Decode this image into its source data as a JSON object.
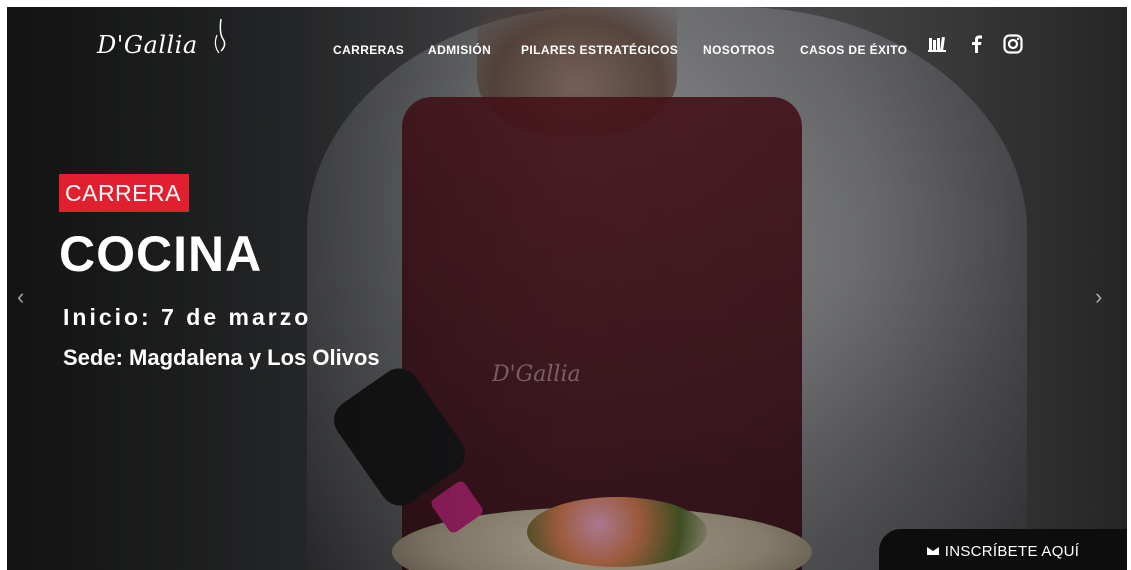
{
  "brand": {
    "logo_text": "D'Gallia"
  },
  "nav": {
    "items": [
      {
        "label": "CARRERAS"
      },
      {
        "label": "ADMISIÓN"
      },
      {
        "label": "PILARES ESTRATÉGICOS"
      },
      {
        "label": "NOSOTROS"
      },
      {
        "label": "CASOS DE ÉXITO"
      }
    ],
    "icons": [
      "library-icon",
      "facebook-icon",
      "instagram-icon"
    ]
  },
  "hero": {
    "badge": "CARRERA",
    "title": "COCINA",
    "start": "Inicio: 7 de marzo",
    "campus": "Sede: Magdalena y Los Olivos"
  },
  "carousel": {
    "prev_icon": "chevron-left-icon",
    "next_icon": "chevron-right-icon"
  },
  "cta": {
    "label": "INSCRÍBETE AQUÍ",
    "icon": "envelope-icon"
  },
  "colors": {
    "badge": "#e21f2f",
    "cta_bg": "#0d0d0d",
    "apron": "#5e1b25"
  }
}
